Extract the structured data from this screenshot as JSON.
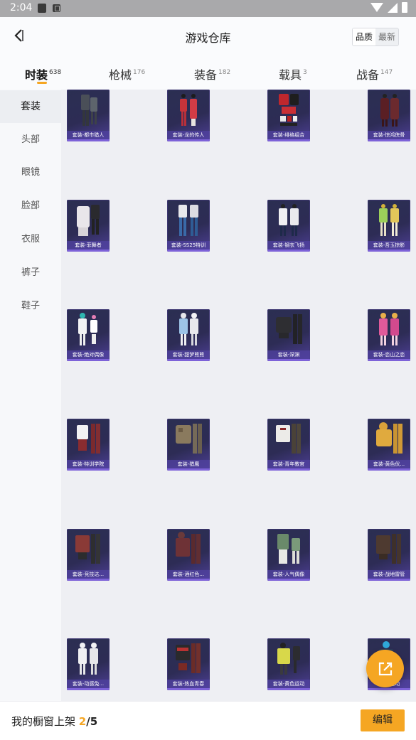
{
  "status_bar": {
    "time": "2:04"
  },
  "header": {
    "title": "游戏仓库",
    "sort_options": [
      "品质",
      "最新"
    ]
  },
  "tabs": [
    {
      "label": "时装",
      "count": "638"
    },
    {
      "label": "枪械",
      "count": "176"
    },
    {
      "label": "装备",
      "count": "182"
    },
    {
      "label": "载具",
      "count": "3"
    },
    {
      "label": "战备",
      "count": "147"
    }
  ],
  "sidebar": {
    "items": [
      "套装",
      "头部",
      "眼镜",
      "脸部",
      "衣服",
      "裤子",
      "鞋子"
    ]
  },
  "items": [
    {
      "name": "套装-都市猎人"
    },
    {
      "name": "套装-龙的传人"
    },
    {
      "name": "套装-绯格组合"
    },
    {
      "name": "套装-惊鸿侠骨"
    },
    {
      "name": "套装-菲舞者"
    },
    {
      "name": "套装-SS25特训"
    },
    {
      "name": "套装-钢衣飞扬"
    },
    {
      "name": "套装-吾玉掠影"
    },
    {
      "name": "套装-绝对偶像"
    },
    {
      "name": "套装-甜梦熊熊"
    },
    {
      "name": "套装-深渊"
    },
    {
      "name": "套装-恋山之恋"
    },
    {
      "name": "套装-特训学院"
    },
    {
      "name": "套装-猎鹰"
    },
    {
      "name": "套装-青年教官"
    },
    {
      "name": "套装-黄色伏..."
    },
    {
      "name": "套装-竞技达..."
    },
    {
      "name": "套装-酒红色..."
    },
    {
      "name": "套装-人气偶像"
    },
    {
      "name": "套装-战地雷管"
    },
    {
      "name": "套装-动感兔..."
    },
    {
      "name": "套装-热血青春"
    },
    {
      "name": "套装-黄色运动"
    },
    {
      "name": "套装-运动"
    }
  ],
  "bottom_bar": {
    "label": "我的橱窗上架",
    "current": "2",
    "separator": "/",
    "total": "5",
    "edit_label": "编辑"
  },
  "colors": {
    "accent": "#f5a623",
    "card": "#2d2c55",
    "caption": "#5042a0"
  },
  "icons": {
    "back": "back-arrow-icon",
    "share": "share-icon"
  }
}
